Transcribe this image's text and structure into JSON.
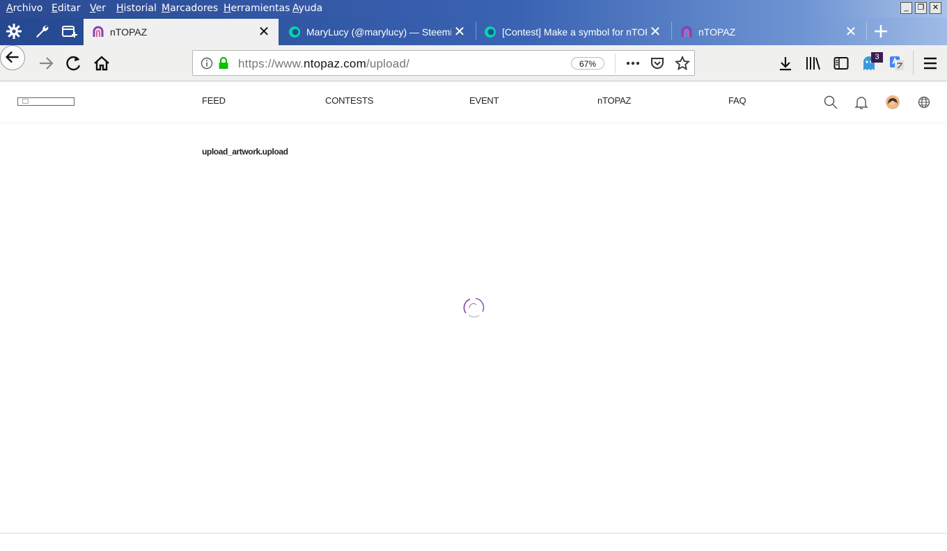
{
  "menubar": {
    "items": [
      "Archivo",
      "Editar",
      "Ver",
      "Historial",
      "Marcadores",
      "Herramientas",
      "Ayuda"
    ]
  },
  "window_controls": {
    "minimize": "_",
    "restore": "❐",
    "close": "✕"
  },
  "tabs": [
    {
      "title": "nTOPAZ",
      "active": true
    },
    {
      "title": "MaryLucy (@marylucy) — Steemit",
      "active": false
    },
    {
      "title": "[Contest] Make a symbol for nTOPAZ",
      "active": false
    },
    {
      "title": "nTOPAZ",
      "active": false
    }
  ],
  "urlbar": {
    "protocol": "https://www.",
    "host": "ntopaz.com",
    "path": "/upload/",
    "zoom": "67%"
  },
  "toolbar": {
    "notification_count": "3"
  },
  "site": {
    "nav": [
      "FEED",
      "CONTESTS",
      "EVENT",
      "nTOPAZ",
      "FAQ"
    ],
    "upload_label": "upload_artwork.upload"
  },
  "colors": {
    "accent": "#7b3fa0",
    "titlebar": "#2b4a93",
    "tab_active": "#f0f0f0"
  }
}
